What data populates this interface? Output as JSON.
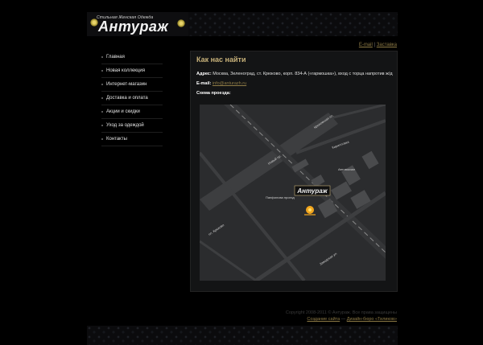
{
  "header": {
    "logo_subtitle": "Стильная Женская Одежда",
    "logo_title": "Антураж"
  },
  "top_links": {
    "email": "E-mail",
    "separator": " | ",
    "sitemap": "Заставка"
  },
  "nav": {
    "items": [
      {
        "label": "Главная"
      },
      {
        "label": "Новая коллекция"
      },
      {
        "label": "Интернет-магазин"
      },
      {
        "label": "Доставка и оплата"
      },
      {
        "label": "Акции и скидки"
      },
      {
        "label": "Уход за одеждой"
      },
      {
        "label": "Контакты"
      }
    ]
  },
  "content": {
    "title": "Как нас найти",
    "address_label": "Адрес:",
    "address_text": " Москва, Зеленоград, ст. Крюково, корп. 834-А («гармошка»), вход с торца напротив ж/д",
    "email_label": "E-mail:",
    "email_value": "info@anturazh.ru",
    "map_label": "Схема проезда:"
  },
  "map": {
    "logo_text": "Антураж",
    "labels": {
      "road1": "Крюковская пл.",
      "road2": "Новый пр.",
      "road3": "Кирилловка",
      "road4": "Автовокзал",
      "road5": "Панфилова проезд",
      "road6": "пл. Крюково",
      "road7": "Заводская ул."
    }
  },
  "footer": {
    "copyright": "Copyright 2008-2011 © Антураж. Все права защищены",
    "creation_label": "Создание сайта",
    "dash": " — ",
    "studio": "Дизайн-бюро «Тиликов»"
  }
}
